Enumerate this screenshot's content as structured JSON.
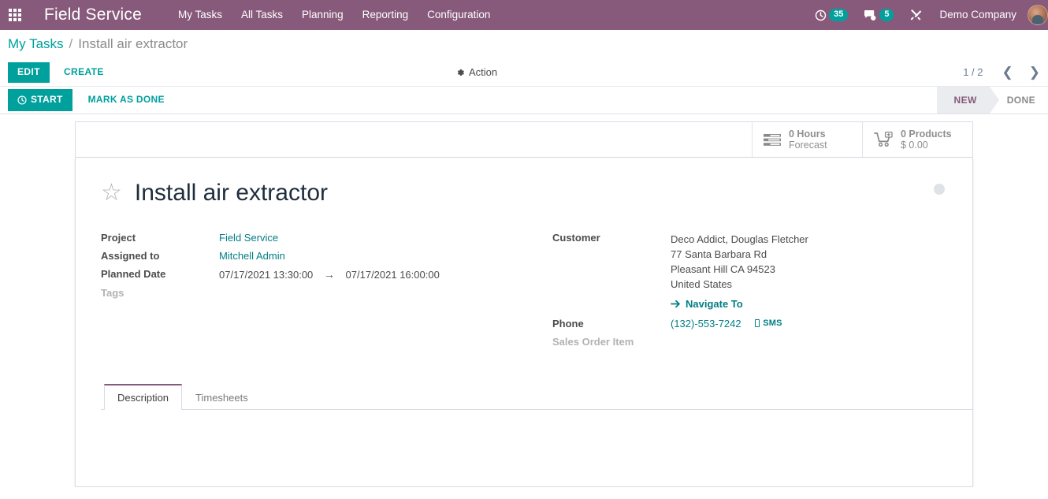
{
  "navbar": {
    "apps_icon": "apps-grid-icon",
    "brand": "Field Service",
    "menu_items": [
      {
        "label": "My Tasks"
      },
      {
        "label": "All Tasks"
      },
      {
        "label": "Planning"
      },
      {
        "label": "Reporting"
      },
      {
        "label": "Configuration"
      }
    ],
    "systray": {
      "activities_icon": "clock-icon",
      "activities_count": "35",
      "messages_icon": "chat-bubble-icon",
      "messages_count": "5",
      "debug_icon": "tools-icon",
      "company": "Demo Company",
      "avatar_icon": "user-avatar"
    }
  },
  "breadcrumb": {
    "parent": "My Tasks",
    "separator": "/",
    "current": "Install air extractor"
  },
  "control_panel": {
    "edit_label": "EDIT",
    "create_label": "CREATE",
    "action_label": "Action",
    "action_icon": "gear-icon",
    "pager": {
      "count": "1 / 2",
      "prev_icon": "chevron-left-icon",
      "next_icon": "chevron-right-icon"
    }
  },
  "status_bar": {
    "start_label": "START",
    "start_icon": "clock-icon",
    "mark_done_label": "MARK AS DONE",
    "stages": [
      {
        "label": "NEW",
        "active": true
      },
      {
        "label": "DONE",
        "active": false
      }
    ]
  },
  "smart_buttons": [
    {
      "icon": "timesheet-bars-icon",
      "value": "0  Hours",
      "label": "Forecast"
    },
    {
      "icon": "shopping-cart-icon",
      "value": "0 Products",
      "label": "$ 0.00"
    }
  ],
  "record": {
    "star_icon": "star-outline-icon",
    "title": "Install air extractor",
    "kanban_state_icon": "kanban-state-dot",
    "left_fields": {
      "project_label": "Project",
      "project_value": "Field Service",
      "assigned_label": "Assigned to",
      "assigned_value": "Mitchell Admin",
      "planned_label": "Planned Date",
      "planned_start": "07/17/2021 13:30:00",
      "planned_arrow": "→",
      "planned_end": "07/17/2021 16:00:00",
      "tags_label": "Tags",
      "tags_value": ""
    },
    "right_fields": {
      "customer_label": "Customer",
      "customer_value": "Deco Addict, Douglas Fletcher",
      "address_line1": "77 Santa Barbara Rd",
      "address_line2": "Pleasant Hill CA 94523",
      "address_country": "United States",
      "navigate_label": "Navigate To",
      "navigate_icon": "arrow-right-icon",
      "phone_label": "Phone",
      "phone_value": "(132)-553-7242",
      "sms_label": "SMS",
      "sms_icon": "mobile-phone-icon",
      "sales_order_label": "Sales Order Item",
      "sales_order_value": ""
    }
  },
  "notebook": {
    "tabs": [
      {
        "label": "Description",
        "active": true
      },
      {
        "label": "Timesheets",
        "active": false
      }
    ]
  },
  "colors": {
    "brand_purple": "#875A7B",
    "accent_teal": "#00A09D",
    "link_teal": "#017e84"
  }
}
